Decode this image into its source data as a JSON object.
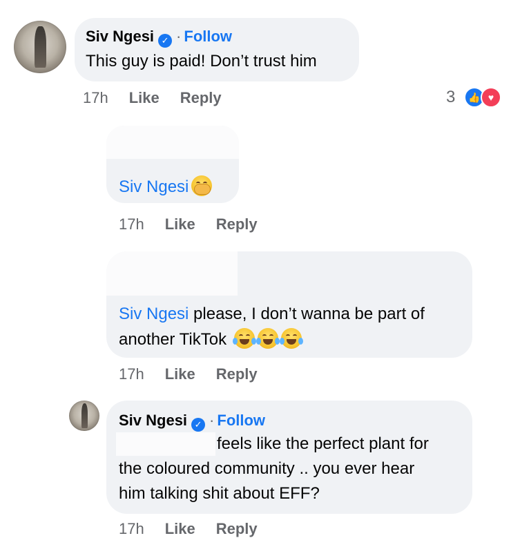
{
  "comments": [
    {
      "author": "Siv Ngesi",
      "follow_label": "Follow",
      "separator": "·",
      "text": "This guy is paid! Don’t trust him",
      "time": "17h",
      "like_label": "Like",
      "reply_label": "Reply",
      "reaction_count": "3",
      "reactions": [
        "like-icon",
        "love-icon"
      ]
    },
    {
      "mention": "Siv Ngesi",
      "emoji": "face-with-hand-over-mouth-emoji",
      "time": "17h",
      "like_label": "Like",
      "reply_label": "Reply"
    },
    {
      "mention": "Siv Ngesi",
      "text_line1": "please, I don’t wanna be part of",
      "text_line2": "another TikTok",
      "emojis": [
        "tears-of-joy-emoji",
        "tears-of-joy-emoji",
        "tears-of-joy-emoji"
      ],
      "time": "17h",
      "like_label": "Like",
      "reply_label": "Reply"
    },
    {
      "author": "Siv Ngesi",
      "follow_label": "Follow",
      "separator": "·",
      "text_line1": "feels like the perfect plant for",
      "text_line2": "the coloured community .. you ever hear",
      "text_line3": "him talking shit about EFF?",
      "time": "17h",
      "like_label": "Like",
      "reply_label": "Reply"
    }
  ],
  "colors": {
    "bubble": "#f0f2f5",
    "link": "#1877f2",
    "meta": "#65676b",
    "love": "#f33e58"
  }
}
